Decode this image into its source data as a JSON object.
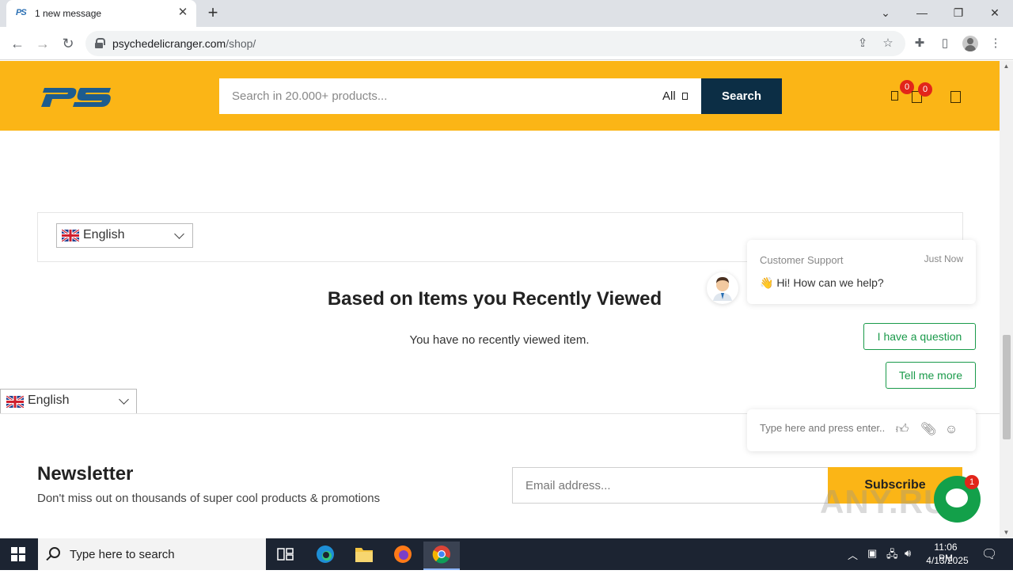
{
  "browser": {
    "tab_title": "1 new message",
    "tab_favicon_text": "PS",
    "url_host": "psychedelicranger.com",
    "url_path": "/shop/"
  },
  "header": {
    "logo_text": "PS",
    "search_placeholder": "Search in 20.000+ products...",
    "category_label": "All",
    "search_button": "Search",
    "wishlist_count": "0",
    "cart_count": "0",
    "brand_color": "#fbb516",
    "search_button_color": "#0c2e45"
  },
  "language": {
    "selected": "English",
    "floating_selected": "English"
  },
  "recently_viewed": {
    "title": "Based on Items you Recently Viewed",
    "empty_text": "You have no recently viewed item."
  },
  "newsletter": {
    "title": "Newsletter",
    "subtitle": "Don't miss out on thousands of super cool products & promotions",
    "email_placeholder": "Email address...",
    "subscribe_label": "Subscribe"
  },
  "chat": {
    "agent_name": "Customer Support",
    "time": "Just Now",
    "message": "👋 Hi! How can we help?",
    "options": [
      "I have a question",
      "Tell me more"
    ],
    "input_placeholder": "Type here and press enter..",
    "unread_count": "1",
    "accent_color": "#13a04a"
  },
  "watermark": "ANY.RUN",
  "taskbar": {
    "search_text": "Type here to search",
    "time": "11:06 PM",
    "date": "4/13/2025"
  }
}
